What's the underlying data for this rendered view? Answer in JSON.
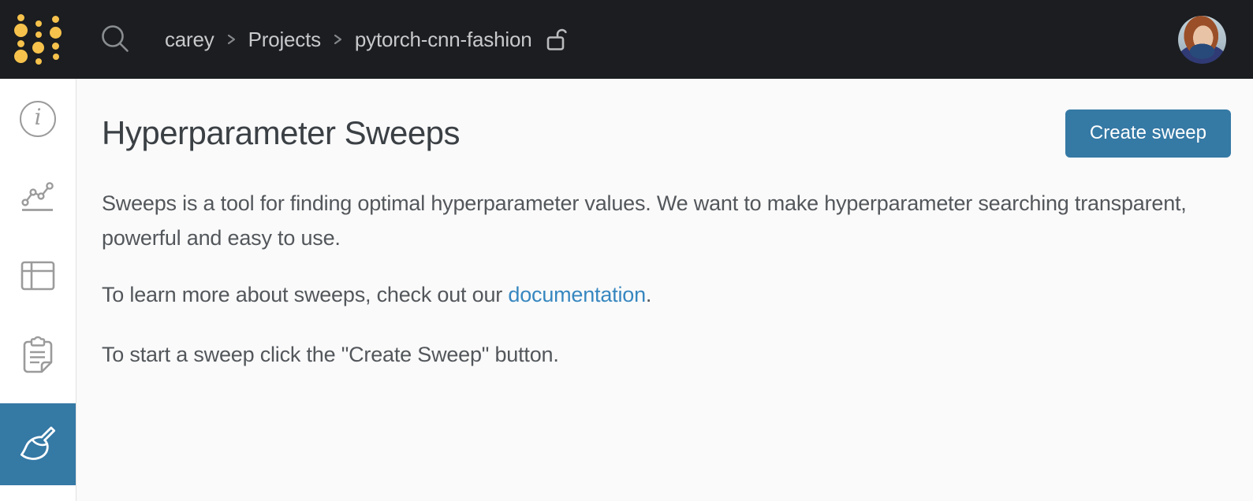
{
  "colors": {
    "topbar_bg": "#1b1d20",
    "accent_blue": "#3579a5",
    "link_blue": "#3787c0",
    "logo_gold": "#f6c24c",
    "main_bg": "#fafafa",
    "sidebar_bg": "#ffffff",
    "heading_text": "#3b4045",
    "body_text": "#53575b",
    "breadcrumb_text": "#c7c9cb"
  },
  "topbar": {
    "logo_icon": "wandb-dots-logo",
    "search_icon": "search-magnifier",
    "breadcrumb": {
      "items": [
        "carey",
        "Projects",
        "pytorch-cnn-fashion"
      ],
      "separator_icon": "chevron-right",
      "privacy_icon": "open-padlock"
    },
    "avatar_icon": "user-profile-photo"
  },
  "sidebar": {
    "items": [
      {
        "icon": "info-circle-icon",
        "active": false
      },
      {
        "icon": "line-chart-icon",
        "active": false
      },
      {
        "icon": "table-icon",
        "active": false
      },
      {
        "icon": "notes-clipboard-icon",
        "active": false
      },
      {
        "icon": "sweeps-broom-icon",
        "active": true
      }
    ],
    "info_glyph": "i"
  },
  "main": {
    "title": "Hyperparameter Sweeps",
    "create_button_label": "Create sweep",
    "paragraphs": {
      "intro": "Sweeps is a tool for finding optimal hyperparameter values. We want to make hyperparameter searching transparent, powerful and easy to use.",
      "docs_before": "To learn more about sweeps, check out our ",
      "docs_link": "documentation",
      "docs_after": ".",
      "start": "To start a sweep click the \"Create Sweep\" button."
    }
  }
}
